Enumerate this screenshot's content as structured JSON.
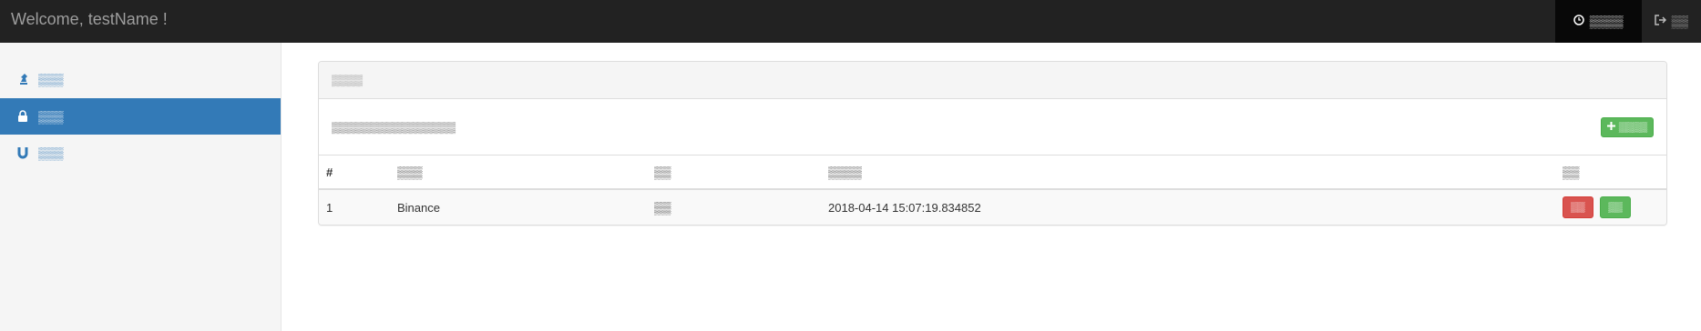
{
  "header": {
    "brand": "Welcome, testName !",
    "clock_label": "▒▒▒▒",
    "logout_label": "▒▒"
  },
  "sidebar": {
    "items": [
      {
        "label": "▒▒▒",
        "icon": "chess-icon",
        "active": false
      },
      {
        "label": "▒▒▒",
        "icon": "lock-icon",
        "active": true
      },
      {
        "label": "▒▒▒",
        "icon": "magnet-icon",
        "active": false
      }
    ]
  },
  "panel": {
    "heading": "▒▒▒▒",
    "description": "▒▒▒▒▒▒▒▒▒▒▒▒▒▒▒▒",
    "add_button_label": "▒▒▒▒",
    "columns": [
      "#",
      "▒▒▒",
      "▒▒",
      "▒▒▒▒",
      "▒▒"
    ],
    "rows": [
      {
        "index": "1",
        "name": "Binance",
        "key": "▒▒",
        "time": "2018-04-14 15:07:19.834852",
        "delete_label": "▒▒",
        "edit_label": "▒▒"
      }
    ]
  },
  "colors": {
    "navbar_bg": "#222222",
    "sidebar_active": "#337ab7",
    "danger": "#d9534f",
    "success": "#5cb85c"
  }
}
